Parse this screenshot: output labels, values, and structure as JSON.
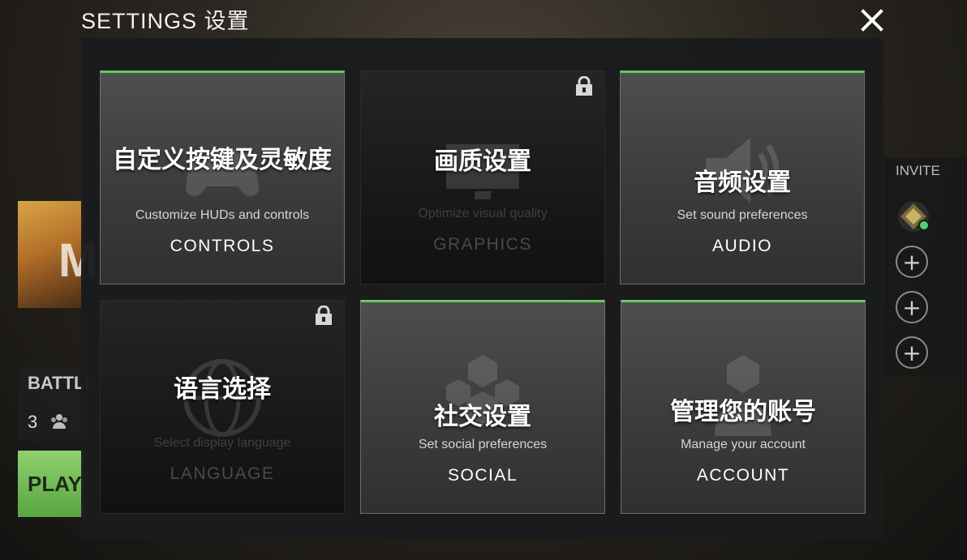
{
  "header": {
    "title": "SETTINGS 设置"
  },
  "background": {
    "mode_letter": "M",
    "battle_label": "BATTLI",
    "party_count": "3",
    "play_label": "PLAY"
  },
  "party_panel": {
    "invite_label": "INVITE",
    "add_slot_glyph": "+"
  },
  "tiles": [
    {
      "title_zh": "自定义按键及灵敏度",
      "description": "Customize HUDs and controls",
      "name": "CONTROLS",
      "locked": false,
      "icon": "gamepad-icon"
    },
    {
      "title_zh": "画质设置",
      "description": "Optimize visual quality",
      "name": "GRAPHICS",
      "locked": true,
      "icon": "display-icon"
    },
    {
      "title_zh": "音频设置",
      "description": "Set sound preferences",
      "name": "AUDIO",
      "locked": false,
      "icon": "speaker-icon"
    },
    {
      "title_zh": "语言选择",
      "description": "Select display language",
      "name": "LANGUAGE",
      "locked": true,
      "icon": "globe-icon"
    },
    {
      "title_zh": "社交设置",
      "description": "Set social preferences",
      "name": "SOCIAL",
      "locked": false,
      "icon": "group-icon"
    },
    {
      "title_zh": "管理您的账号",
      "description": "Manage your account",
      "name": "ACCOUNT",
      "locked": false,
      "icon": "user-icon"
    }
  ],
  "colors": {
    "accent": "#67c95f",
    "panel": "#1a1b1c",
    "tile": "#3b3c3c",
    "locked_tile": "#181818"
  }
}
